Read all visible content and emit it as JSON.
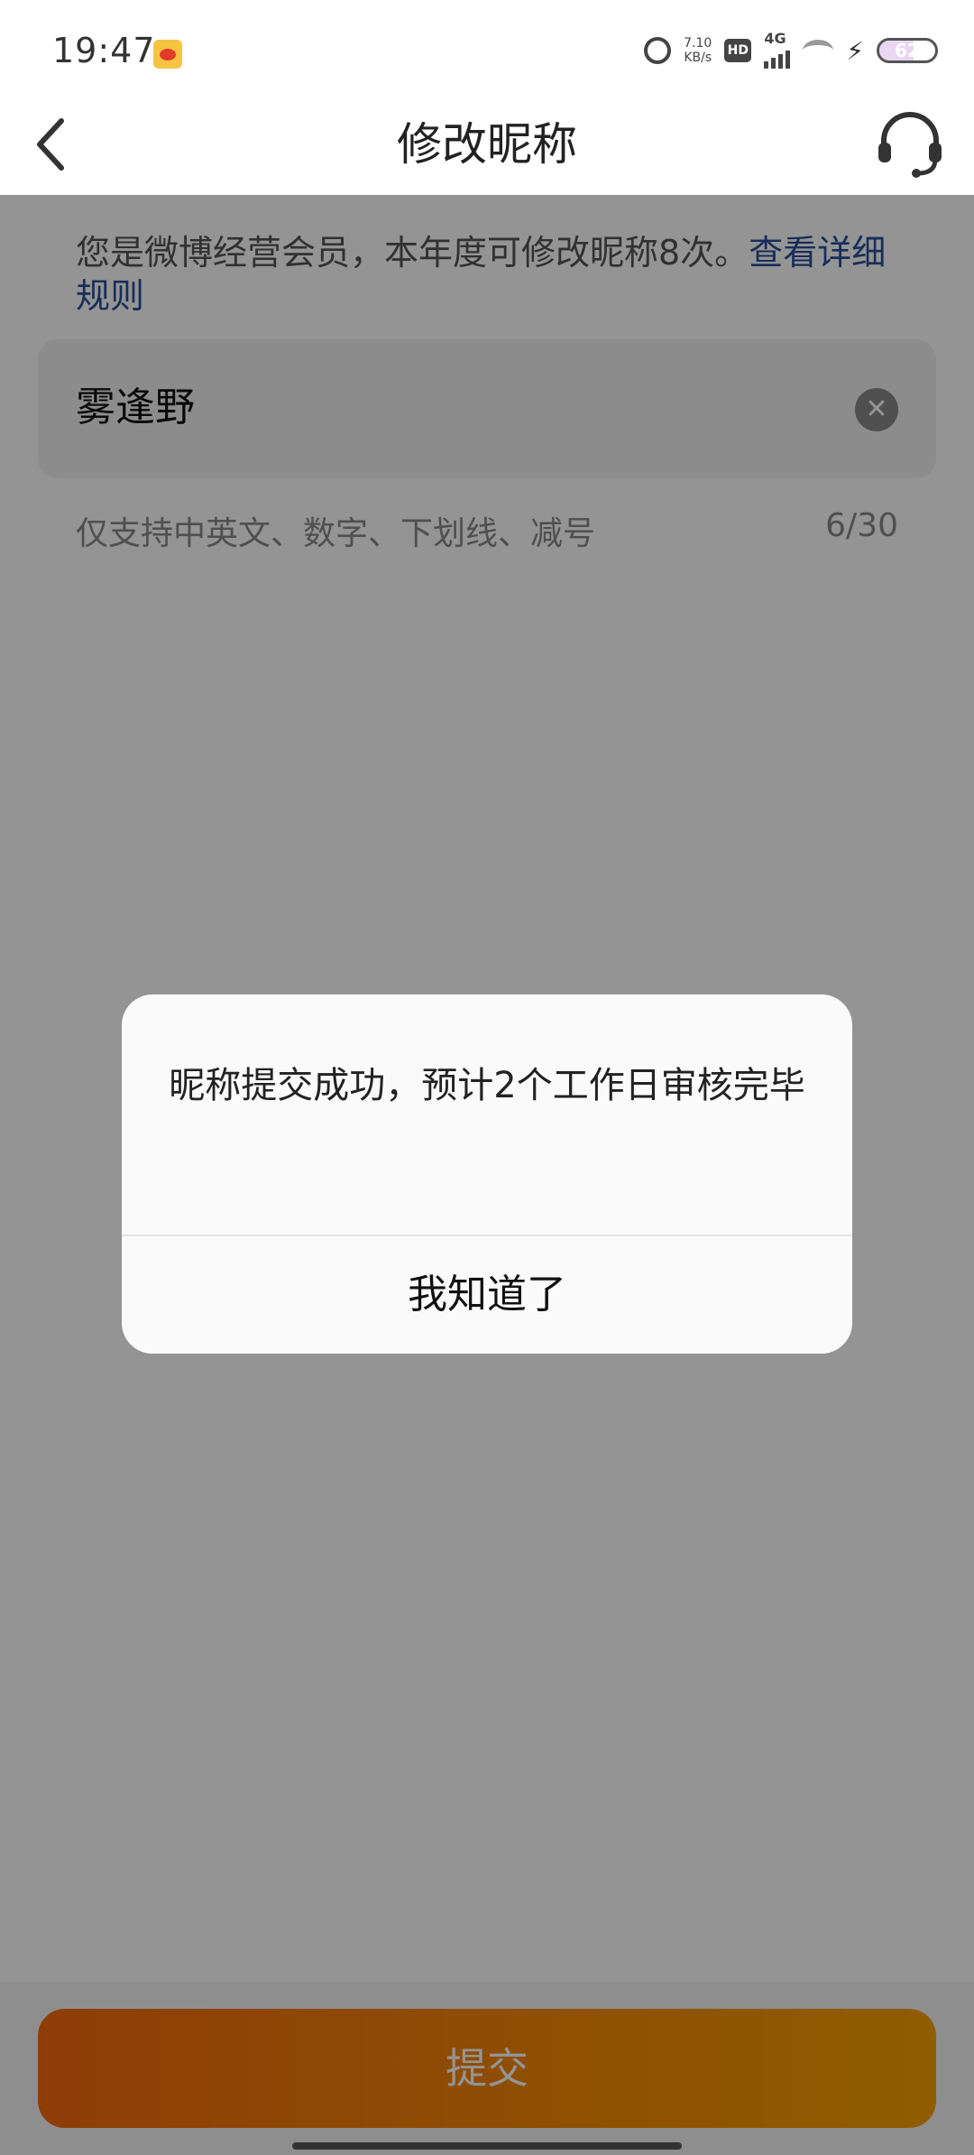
{
  "status_bar": {
    "time": "19:47",
    "net_speed_value": "7.10",
    "net_speed_unit": "KB/s",
    "hd_label": "HD",
    "network_label": "4G",
    "battery": "62",
    "battery_level": 0.62
  },
  "nav": {
    "title": "修改昵称"
  },
  "notice": {
    "text": "您是微博经营会员，本年度可修改昵称8次。",
    "link": "查看详细规则"
  },
  "nickname": {
    "value": "雾逢野",
    "clear_symbol": "✕"
  },
  "hint": {
    "rules": "仅支持中英文、数字、下划线、减号",
    "counter": "6/30"
  },
  "submit": {
    "label": "提交"
  },
  "dialog": {
    "message": "昵称提交成功，预计2个工作日审核完毕",
    "button": "我知道了"
  },
  "colors": {
    "link": "#2b4f9a",
    "submit_start": "#f46a0c",
    "submit_end": "#f8a000"
  }
}
